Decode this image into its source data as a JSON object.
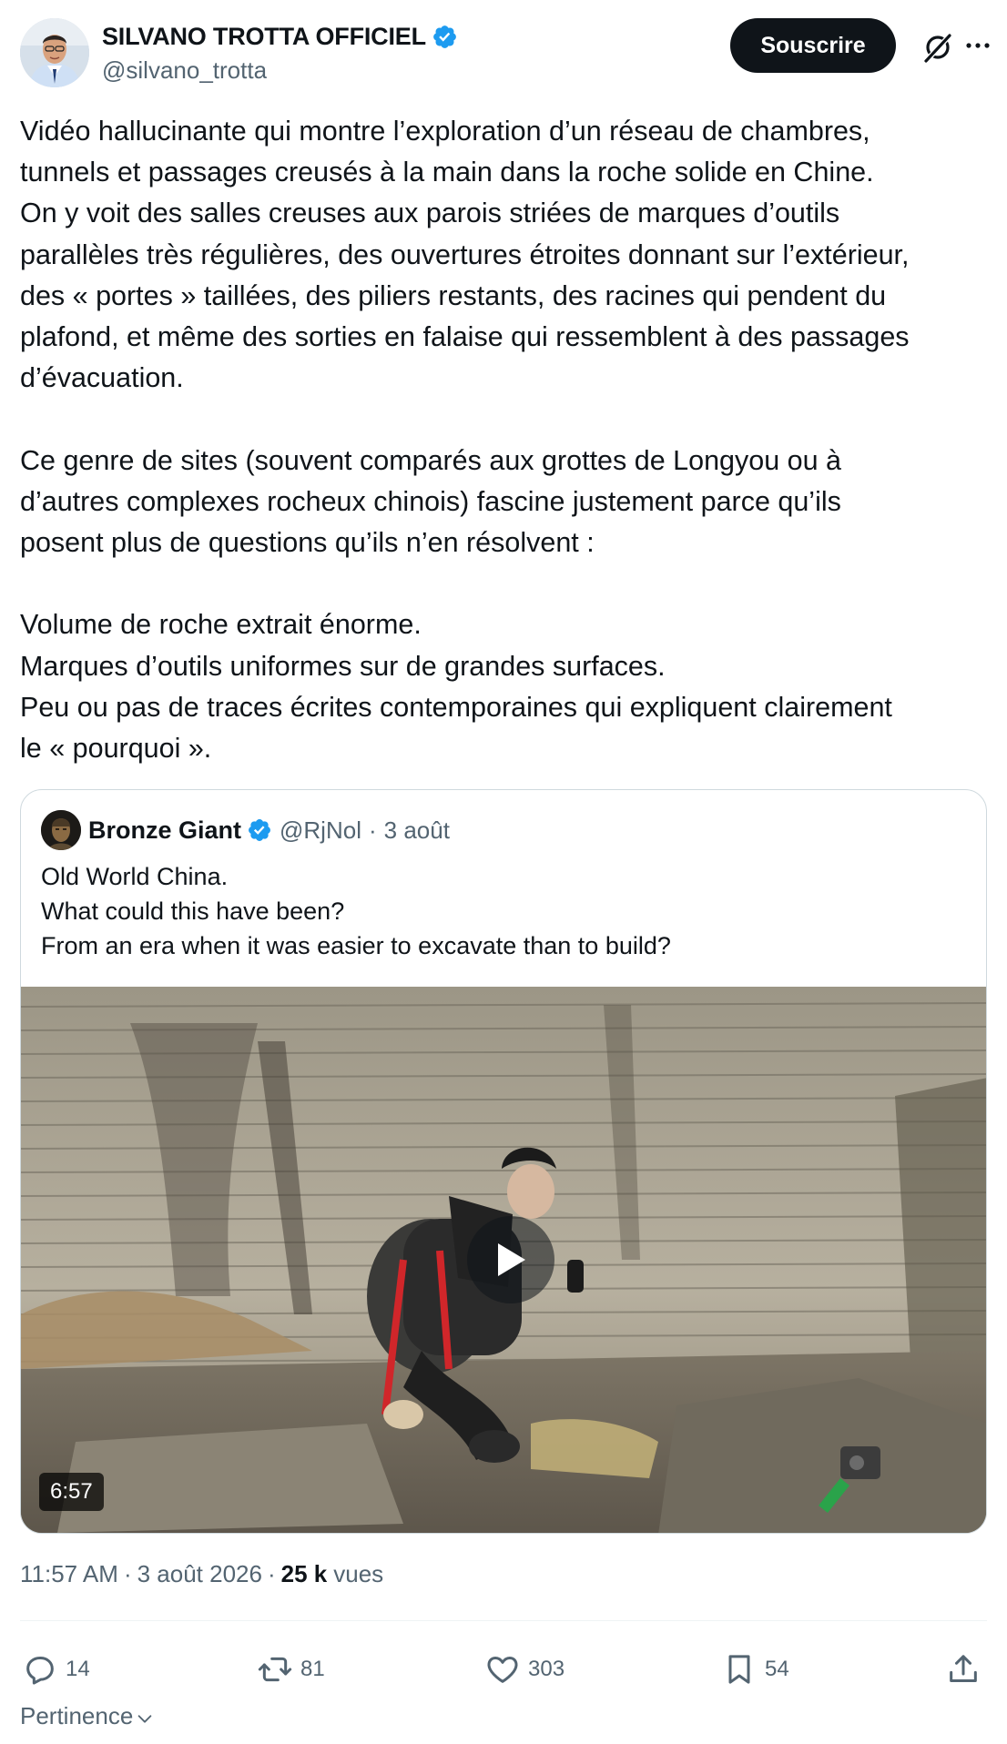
{
  "author": {
    "name": "SILVANO TROTTA OFFICIEL",
    "handle": "@silvano_trotta"
  },
  "header": {
    "subscribe_label": "Souscrire"
  },
  "tweet": {
    "text": "Vidéo hallucinante qui montre l’exploration d’un réseau de chambres,\ntunnels et passages creusés à la main dans la roche solide en Chine.\nOn y voit des salles creuses aux parois striées de marques d’outils\nparallèles très régulières, des ouvertures étroites donnant sur l’extérieur,\ndes « portes » taillées, des piliers restants, des racines qui pendent du\nplafond, et même des sorties en falaise qui ressemblent à des passages\nd’évacuation.\n\nCe genre de sites (souvent comparés aux grottes de Longyou ou à\nd’autres complexes rocheux chinois) fascine justement parce qu’ils\nposent plus de questions qu’ils n’en résolvent :\n\nVolume de roche extrait énorme.\nMarques d’outils uniformes sur de grandes surfaces.\nPeu ou pas de traces écrites contemporaines qui expliquent clairement\nle « pourquoi »."
  },
  "quote": {
    "name": "Bronze Giant",
    "handle": "@RjNol",
    "separator": "·",
    "date": "3 août",
    "text": "Old World China.\nWhat could this have been?\nFrom an era when it was easier to excavate than to build?",
    "video_duration": "6:57"
  },
  "meta": {
    "time": "11:57 AM",
    "separator": "·",
    "date": "3 août 2026",
    "separator2": "·",
    "views_count": "25 k",
    "views_label": "vues"
  },
  "actions": {
    "replies": "14",
    "reposts": "81",
    "likes": "303",
    "bookmarks": "54"
  },
  "sort_label": "Pertinence",
  "colors": {
    "verified": "#1d9bf0",
    "text": "#0f1419",
    "secondary": "#536471"
  }
}
